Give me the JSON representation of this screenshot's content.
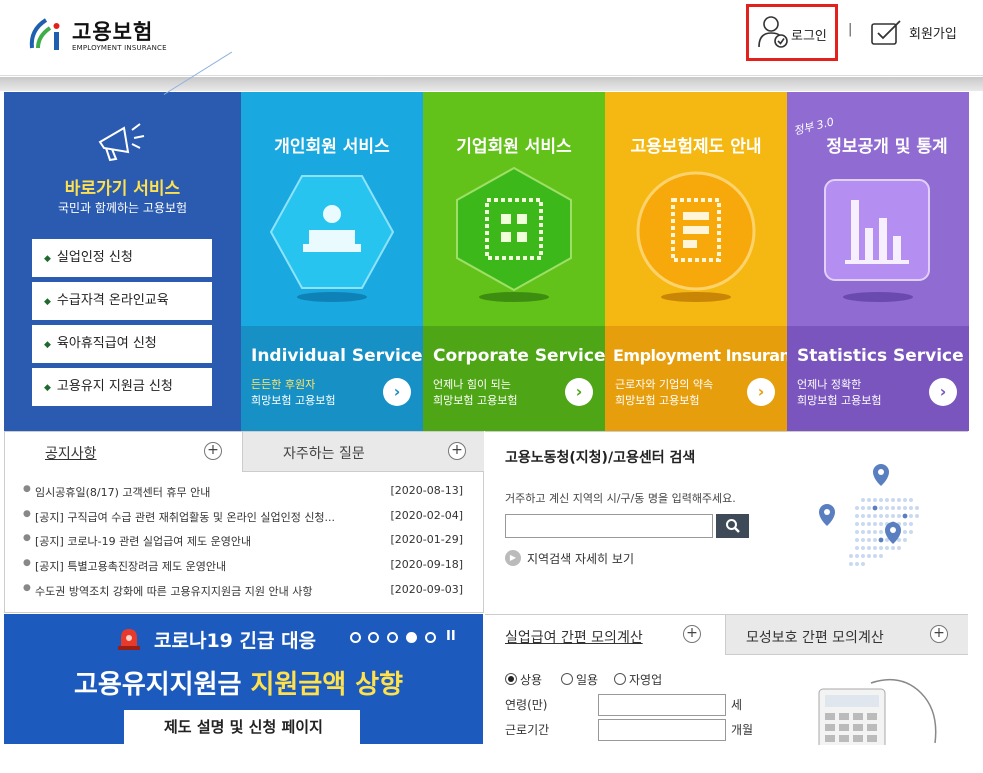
{
  "header": {
    "logo_main": "고용보험",
    "logo_sub": "EMPLOYMENT INSURANCE",
    "login_label": "로그인",
    "separator": "|",
    "join_label": "회원가입"
  },
  "quick": {
    "title": "바로가기 서비스",
    "subtitle": "국민과 함께하는 고용보험",
    "items": [
      "실업인정 신청",
      "수급자격 온라인교육",
      "육아휴직급여 신청",
      "고용유지 지원금 신청"
    ]
  },
  "tiles": [
    {
      "title": "개인회원 서비스",
      "en": "Individual Service",
      "desc1": "든든한 후원자",
      "desc2": "희망보험 고용보험",
      "color": "#19a9e0",
      "bottom": "#1790c6",
      "desc_color": "#ffe46b",
      "arrow_color": "#1790c6"
    },
    {
      "title": "기업회원 서비스",
      "en": "Corporate Service",
      "desc1": "언제나 힘이 되는",
      "desc2": "희망보험 고용보험",
      "color": "#63c21a",
      "bottom": "#4ea515",
      "desc_color": "#ffffff",
      "arrow_color": "#4ea515"
    },
    {
      "title": "고용보험제도 안내",
      "en": "Employment Insurance",
      "desc1": "근로자와 기업의 약속",
      "desc2": "희망보험 고용보험",
      "color": "#f5b812",
      "bottom": "#e69e0c",
      "desc_color": "#ffffff",
      "arrow_color": "#e69e0c"
    },
    {
      "title": "정보공개 및 통계",
      "tag": "정부 3.0",
      "en": "Statistics Service",
      "desc1": "언제나 정확한",
      "desc2": "희망보험 고용보험",
      "color": "#8f6bd2",
      "bottom": "#7955bd",
      "desc_color": "#ffffff",
      "arrow_color": "#7955bd"
    }
  ],
  "notice": {
    "tab1": "공지사항",
    "tab2": "자주하는 질문",
    "plus": "+",
    "rows": [
      {
        "title": "임시공휴일(8/17) 고객센터 휴무 안내",
        "date": "[2020-08-13]"
      },
      {
        "title": "[공지] 구직급여 수급 관련 재취업활동 및 온라인 실업인정 신청...",
        "date": "[2020-02-04]"
      },
      {
        "title": "[공지] 코로나-19 관련 실업급여 제도 운영안내",
        "date": "[2020-01-29]"
      },
      {
        "title": "[공지] 특별고용촉진장려금 제도 운영안내",
        "date": "[2020-09-18]"
      },
      {
        "title": "수도권 방역조치 강화에 따른 고용유지지원금 지원 안내 사항",
        "date": "[2020-09-03]"
      }
    ]
  },
  "office": {
    "title": "고용노동청(지청)/고용센터 검색",
    "desc": "거주하고 계신 지역의 시/구/동 명을 입력해주세요.",
    "input_value": "",
    "detail_link": "지역검색 자세히 보기"
  },
  "banner": {
    "line1": "코로나19 긴급 대응",
    "line2a": "고용유지지원금 ",
    "line2b": "지원금액 상향",
    "line3": "제도 설명 및 신청 페이지",
    "pause": "II",
    "active_slide": 4,
    "slide_count": 5
  },
  "calc": {
    "tab1": "실업급여 간편 모의계산",
    "tab2": "모성보호 간편 모의계산",
    "radios": [
      {
        "label": "상용",
        "checked": true
      },
      {
        "label": "일용",
        "checked": false
      },
      {
        "label": "자영업",
        "checked": false
      }
    ],
    "age_label": "연령(만)",
    "age_unit": "세",
    "period_label": "근로기간",
    "period_unit": "개월"
  }
}
